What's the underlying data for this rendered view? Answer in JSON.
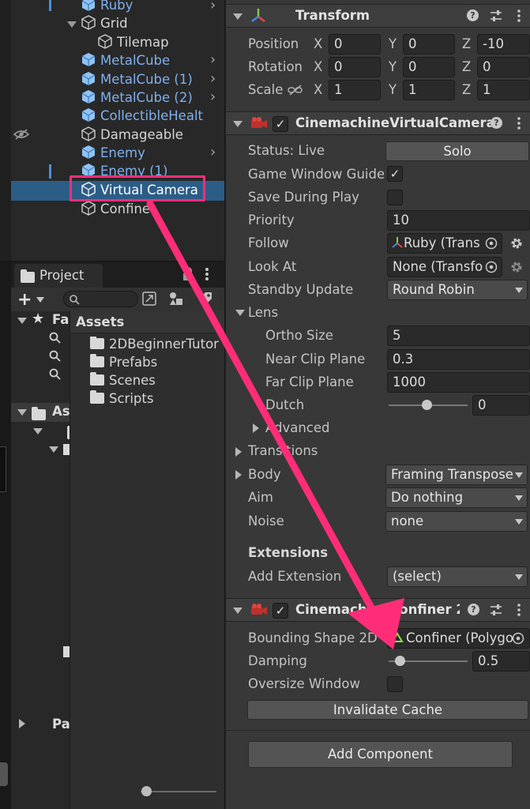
{
  "hierarchy": {
    "items": [
      {
        "label": "Ruby",
        "style": "blue",
        "chevron": true
      },
      {
        "label": "Grid",
        "style": "wht",
        "chevron": false
      },
      {
        "label": "Tilemap",
        "style": "wht",
        "chevron": false
      },
      {
        "label": "MetalCube",
        "style": "blue",
        "chevron": true
      },
      {
        "label": "MetalCube (1)",
        "style": "blue",
        "chevron": true
      },
      {
        "label": "MetalCube (2)",
        "style": "blue",
        "chevron": true
      },
      {
        "label": "CollectibleHealt",
        "style": "blue",
        "chevron": false
      },
      {
        "label": "Damageable",
        "style": "wht",
        "chevron": false
      },
      {
        "label": "Enemy",
        "style": "blue",
        "chevron": true
      },
      {
        "label": "Enemy (1)",
        "style": "blue",
        "chevron": true
      },
      {
        "label": "Virtual Camera",
        "style": "selected",
        "chevron": false
      },
      {
        "label": "Confiner",
        "style": "wht",
        "chevron": false
      }
    ]
  },
  "project": {
    "tab_label": "Project",
    "assets_header": "Assets",
    "favorites_label": "Fa",
    "assets_tree_label": "As",
    "packages_label": "Pa",
    "folders": [
      "2DBeginnerTutor",
      "Prefabs",
      "Scenes",
      "Scripts"
    ]
  },
  "inspector": {
    "transform": {
      "title": "Transform",
      "rows": [
        {
          "label": "Position",
          "x": "0",
          "y": "0",
          "z": "-10"
        },
        {
          "label": "Rotation",
          "x": "0",
          "y": "0",
          "z": "0"
        },
        {
          "label": "Scale",
          "x": "1",
          "y": "1",
          "z": "1"
        }
      ],
      "axis_x": "X",
      "axis_y": "Y",
      "axis_z": "Z"
    },
    "vcam": {
      "title": "CinemachineVirtualCamera",
      "status_label": "Status: Live",
      "solo_label": "Solo",
      "guides_label": "Game Window Guides",
      "save_label": "Save During Play",
      "priority_label": "Priority",
      "priority_value": "10",
      "follow_label": "Follow",
      "follow_value": "Ruby (Trans",
      "lookat_label": "Look At",
      "lookat_value": "None (Transfo",
      "standby_label": "Standby Update",
      "standby_value": "Round Robin",
      "lens_label": "Lens",
      "ortho_label": "Ortho Size",
      "ortho_value": "5",
      "near_label": "Near Clip Plane",
      "near_value": "0.3",
      "far_label": "Far Clip Plane",
      "far_value": "1000",
      "dutch_label": "Dutch",
      "dutch_value": "0",
      "advanced_label": "Advanced",
      "transitions_label": "Transitions",
      "body_label": "Body",
      "body_value": "Framing Transpose",
      "aim_label": "Aim",
      "aim_value": "Do nothing",
      "noise_label": "Noise",
      "noise_value": "none",
      "extensions_label": "Extensions",
      "add_ext_label": "Add Extension",
      "add_ext_value": "(select)"
    },
    "confiner": {
      "title": "CinemachineConfiner 2D",
      "bounding_label": "Bounding Shape 2D",
      "bounding_value": "Confiner (Polygo",
      "damping_label": "Damping",
      "damping_value": "0.5",
      "oversize_label": "Oversize Window",
      "invalidate_label": "Invalidate Cache"
    },
    "add_component_label": "Add Component"
  },
  "colors": {
    "highlight": "#ff2d78",
    "selection": "#2c5d87",
    "link_blue": "#7fb0ee"
  }
}
